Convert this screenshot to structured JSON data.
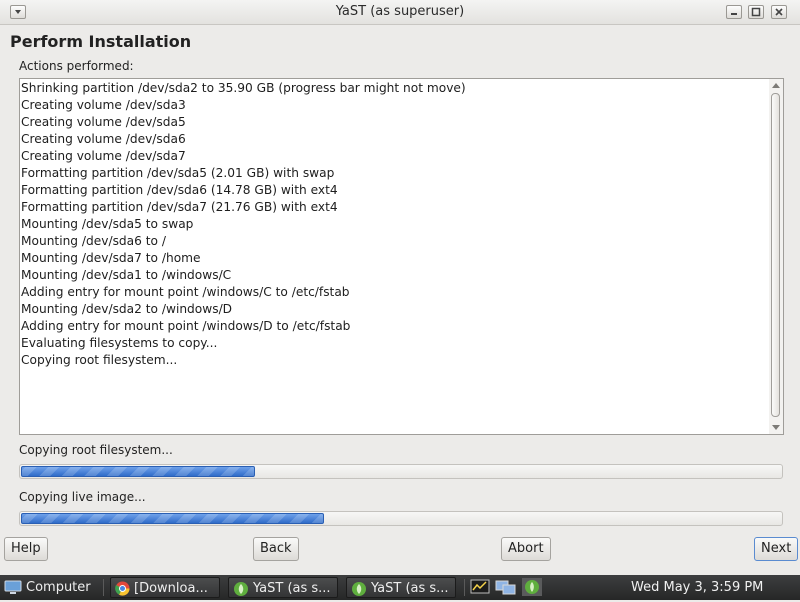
{
  "window": {
    "title": "YaST (as superuser)"
  },
  "page": {
    "heading": "Perform Installation",
    "actions_label": "Actions performed:",
    "log_lines": [
      "Shrinking partition /dev/sda2 to 35.90 GB (progress bar might not move)",
      "Creating volume /dev/sda3",
      "Creating volume /dev/sda5",
      "Creating volume /dev/sda6",
      "Creating volume /dev/sda7",
      "Formatting partition /dev/sda5 (2.01 GB) with swap",
      "Formatting partition /dev/sda6 (14.78 GB) with ext4",
      "Formatting partition /dev/sda7 (21.76 GB) with ext4",
      "Mounting /dev/sda5 to swap",
      "Mounting /dev/sda6 to /",
      "Mounting /dev/sda7 to /home",
      "Mounting /dev/sda1 to /windows/C",
      "Adding entry for mount point /windows/C to /etc/fstab",
      "Mounting /dev/sda2 to /windows/D",
      "Adding entry for mount point /windows/D to /etc/fstab",
      "Evaluating filesystems to copy...",
      "Copying root filesystem..."
    ],
    "progress": [
      {
        "label": "Copying root filesystem...",
        "fraction": 0.31
      },
      {
        "label": "Copying live image...",
        "fraction": 0.4
      }
    ]
  },
  "buttons": {
    "help": "Help",
    "back": "Back",
    "abort": "Abort",
    "next": "Next"
  },
  "taskbar": {
    "start_label": "Computer",
    "tasks": [
      {
        "label": "[Downloa...",
        "icon": "chrome-icon"
      },
      {
        "label": "YaST (as s...",
        "icon": "yast-icon"
      },
      {
        "label": "YaST (as s...",
        "icon": "yast-icon"
      }
    ],
    "tray_icons": [
      "system-monitor-icon",
      "network-icon",
      "update-icon"
    ],
    "clock": "Wed May  3,  3:59 PM"
  },
  "colors": {
    "progress_fill": "#3b7ad8",
    "taskbar_bg": "#2f3030",
    "window_bg": "#ecebe9"
  }
}
